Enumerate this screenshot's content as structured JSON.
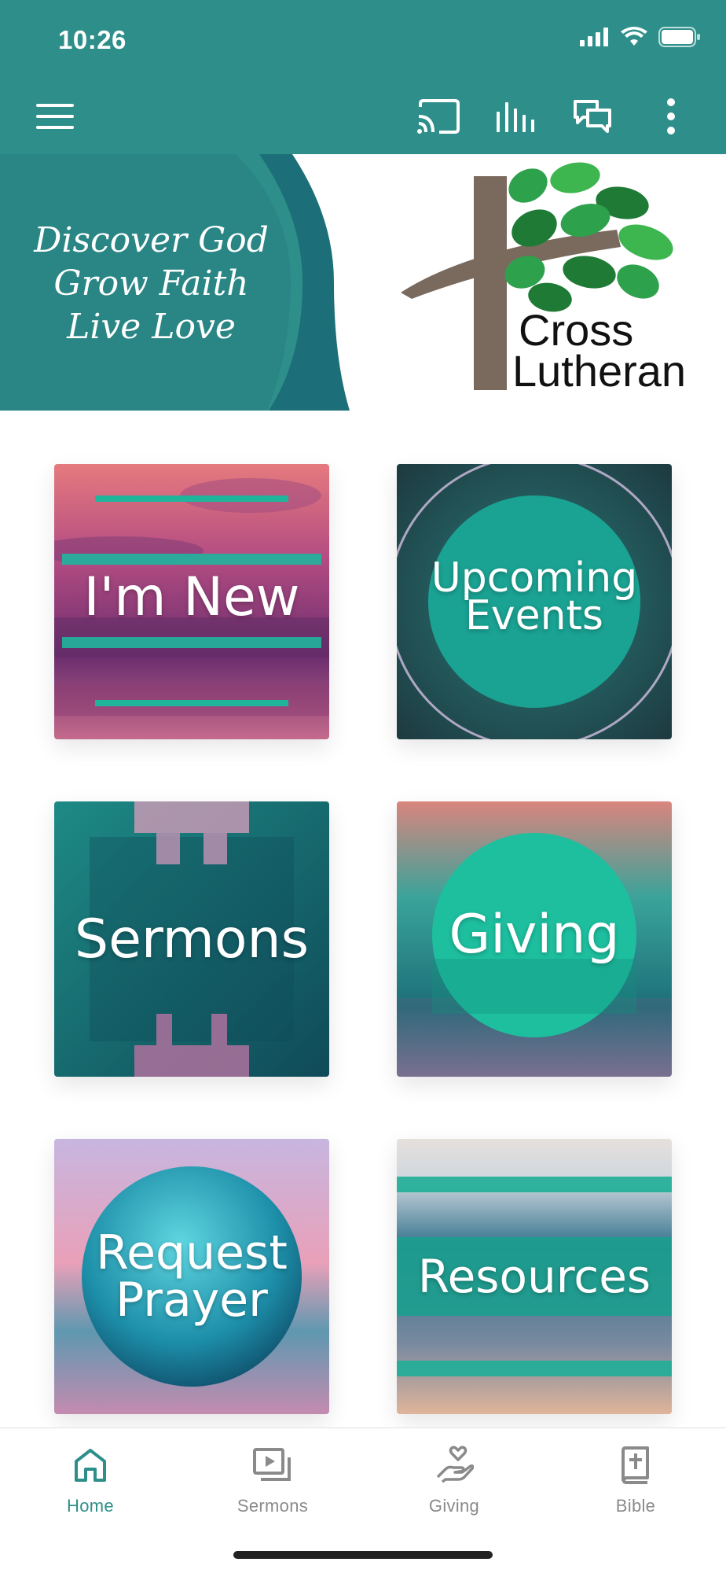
{
  "status_bar": {
    "time": "10:26"
  },
  "app_bar": {
    "icons": [
      "menu-icon",
      "cast-icon",
      "equalizer-icon",
      "chat-icon",
      "more-vert-icon"
    ]
  },
  "banner": {
    "tagline": [
      "Discover God",
      "Grow Faith",
      "Live Love"
    ],
    "logo": {
      "line1": "Cross",
      "line2": "Lutheran"
    }
  },
  "tiles": [
    {
      "label": "I'm New"
    },
    {
      "label_line1": "Upcoming",
      "label_line2": "Events"
    },
    {
      "label": "Sermons"
    },
    {
      "label": "Giving"
    },
    {
      "label_line1": "Request",
      "label_line2": "Prayer"
    },
    {
      "label": "Resources"
    }
  ],
  "bottom_nav": [
    {
      "label": "Home",
      "icon": "home-icon",
      "active": true
    },
    {
      "label": "Sermons",
      "icon": "video-library-icon",
      "active": false
    },
    {
      "label": "Giving",
      "icon": "giving-hand-icon",
      "active": false
    },
    {
      "label": "Bible",
      "icon": "bible-icon",
      "active": false
    }
  ],
  "colors": {
    "primary": "#2e8f8a",
    "teal_accent": "#1fb59d",
    "inactive": "#8a8a8a"
  }
}
